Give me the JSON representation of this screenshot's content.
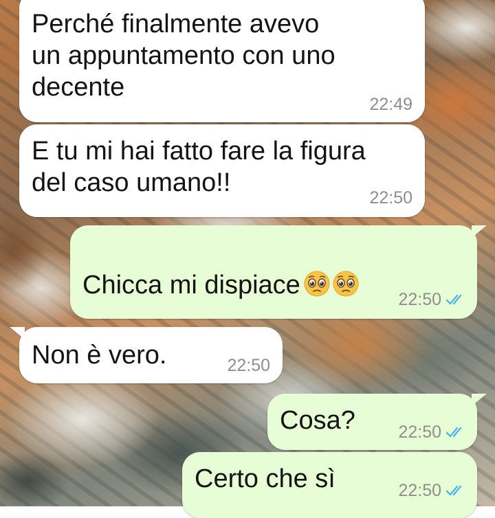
{
  "messages": [
    {
      "direction": "incoming",
      "text": "Perché finalmente avevo\nun appuntamento con uno\ndecente",
      "time": "22:49"
    },
    {
      "direction": "incoming",
      "text": "E tu mi hai fatto fare la figura\ndel caso umano!!",
      "time": "22:50"
    },
    {
      "direction": "outgoing",
      "text": "Chicca mi dispiace",
      "time": "22:50",
      "emoji": [
        "pleading-face-icon",
        "pleading-face-icon"
      ],
      "status": "read"
    },
    {
      "direction": "incoming",
      "text": "Non è vero.",
      "time": "22:50"
    },
    {
      "direction": "outgoing",
      "text": "Cosa?",
      "time": "22:50",
      "status": "read"
    },
    {
      "direction": "outgoing",
      "text": "Certo che sì",
      "time": "22:50",
      "status": "read"
    }
  ],
  "colors": {
    "incoming_bubble": "#ffffff",
    "outgoing_bubble": "#e7fdd6",
    "time_text": "#8e8e8e",
    "read_ticks": "#4fb6ec"
  }
}
